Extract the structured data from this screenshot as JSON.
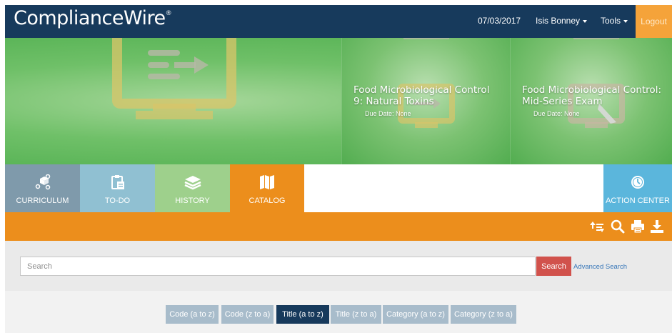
{
  "header": {
    "brand": "ComplianceWire",
    "brand_mark": "®",
    "date": "07/03/2017",
    "user": "Isis Bonney",
    "tools": "Tools",
    "logout": "Logout"
  },
  "banner": {
    "courses": [
      {
        "title_line1": "Food Microbiological Control",
        "title_line2": "9: Natural Toxins",
        "due": "Due Date: None"
      },
      {
        "title_line1": "Food Microbiological Control:",
        "title_line2": "Mid-Series Exam",
        "due": "Due Date: None"
      }
    ]
  },
  "tabs": [
    {
      "label": "CURRICULUM",
      "icon": "curriculum-icon"
    },
    {
      "label": "TO-DO",
      "icon": "clipboard-icon"
    },
    {
      "label": "HISTORY",
      "icon": "layers-icon"
    },
    {
      "label": "CATALOG",
      "icon": "book-icon",
      "active": true
    },
    {
      "label": "ACTION CENTER",
      "icon": "clock-icon"
    }
  ],
  "toolbar": {
    "icons": [
      "sort-icon",
      "search-icon",
      "print-icon",
      "download-icon"
    ]
  },
  "search": {
    "placeholder": "Search",
    "button": "Search",
    "advanced": "Advanced Search"
  },
  "sort": {
    "options": [
      "Code (a to z)",
      "Code (z to a)",
      "Title (a to z)",
      "Title (z to a)",
      "Category (a to z)",
      "Category (z to a)"
    ],
    "active": "Title (a to z)"
  },
  "colors": {
    "header": "#173a5c",
    "logout": "#f5a33a",
    "catalog_orange": "#ec8e1c",
    "search_button": "#d1524c",
    "sort_button": "#a8bccb",
    "sort_active": "#173a5c"
  }
}
